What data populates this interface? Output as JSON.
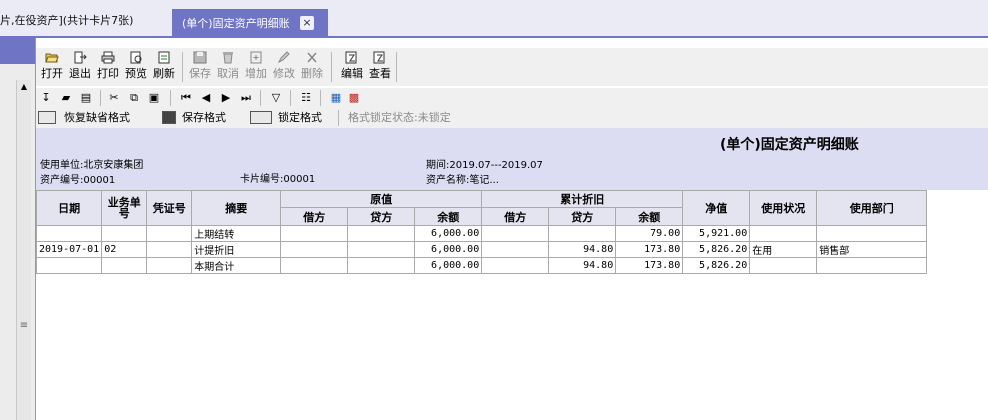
{
  "tabs": [
    {
      "label": "片,在役资产](共计卡片7张)",
      "active": false
    },
    {
      "label": "(单个)固定资产明细账",
      "active": true,
      "close": "×"
    }
  ],
  "toolbar": {
    "open": "打开",
    "exit": "退出",
    "print": "打印",
    "preview": "预览",
    "refresh": "刷新",
    "save": "保存",
    "cancel": "取消",
    "add": "增加",
    "modify": "修改",
    "delete": "删除",
    "edit": "编辑",
    "view": "查看"
  },
  "format_bar": {
    "restore_default": "恢复缺省格式",
    "save_format": "保存格式",
    "lock_format": "锁定格式",
    "lock_status": "格式锁定状态:未锁定"
  },
  "report": {
    "title": "(单个)固定资产明细账",
    "unit": "使用单位:北京安康集团",
    "period": "期间:2019.07---2019.07",
    "asset_no": "资产编号:00001",
    "card_no": "卡片编号:00001",
    "asset_name": "资产名称:笔记..."
  },
  "table": {
    "headers": {
      "date": "日期",
      "doc_no": "业务单号",
      "voucher": "凭证号",
      "summary": "摘要",
      "original": "原值",
      "accum_dep": "累计折旧",
      "debit": "借方",
      "credit": "贷方",
      "balance": "余额",
      "net": "净值",
      "status": "使用状况",
      "dept": "使用部门"
    },
    "rows": [
      {
        "date": "",
        "doc": "",
        "voucher": "",
        "summary": "上期结转",
        "o_debit": "",
        "o_credit": "",
        "o_bal": "6,000.00",
        "d_debit": "",
        "d_credit": "",
        "d_bal": "79.00",
        "net": "5,921.00",
        "status": "",
        "dept": ""
      },
      {
        "date": "2019-07-01",
        "doc": "02",
        "voucher": "",
        "summary": "计提折旧",
        "o_debit": "",
        "o_credit": "",
        "o_bal": "6,000.00",
        "d_debit": "",
        "d_credit": "94.80",
        "d_bal": "173.80",
        "net": "5,826.20",
        "status": "在用",
        "dept": "销售部"
      },
      {
        "date": "",
        "doc": "",
        "voucher": "",
        "summary": "本期合计",
        "o_debit": "",
        "o_credit": "",
        "o_bal": "6,000.00",
        "d_debit": "",
        "d_credit": "94.80",
        "d_bal": "173.80",
        "net": "5,826.20",
        "status": "",
        "dept": ""
      }
    ]
  },
  "colors": {
    "accent": "#6f74c4",
    "header_bg": "#dcdcf2"
  }
}
